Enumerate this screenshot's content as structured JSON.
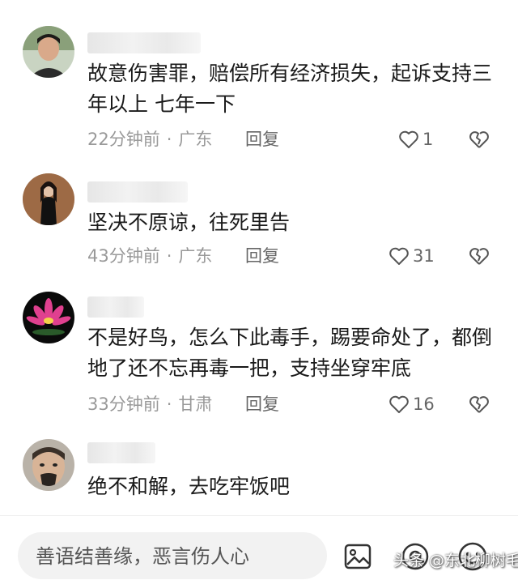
{
  "comments": [
    {
      "text": "故意伤害罪，赔偿所有经济损失，起诉支持三年以上 七年一下",
      "time": "22分钟前",
      "location": "广东",
      "reply_label": "回复",
      "likes": "1"
    },
    {
      "text": "坚决不原谅，往死里告",
      "time": "43分钟前",
      "location": "广东",
      "reply_label": "回复",
      "likes": "31"
    },
    {
      "text": "不是好鸟，怎么下此毒手，踢要命处了，都倒地了还不忘再毒一把，支持坐穿牢底",
      "time": "33分钟前",
      "location": "甘肃",
      "reply_label": "回复",
      "likes": "16"
    },
    {
      "text": "绝不和解，去吃牢饭吧"
    }
  ],
  "input": {
    "placeholder": "善语结善缘，恶言伤人心"
  },
  "watermark": "头条 @东北柳树毛",
  "icons": {
    "like": "heart-outline-icon",
    "dislike": "broken-heart-icon",
    "image": "image-icon",
    "at": "at-icon",
    "emoji": "emoji-icon"
  },
  "colors": {
    "meta_gray": "#999999",
    "input_bg": "#f2f2f2"
  }
}
